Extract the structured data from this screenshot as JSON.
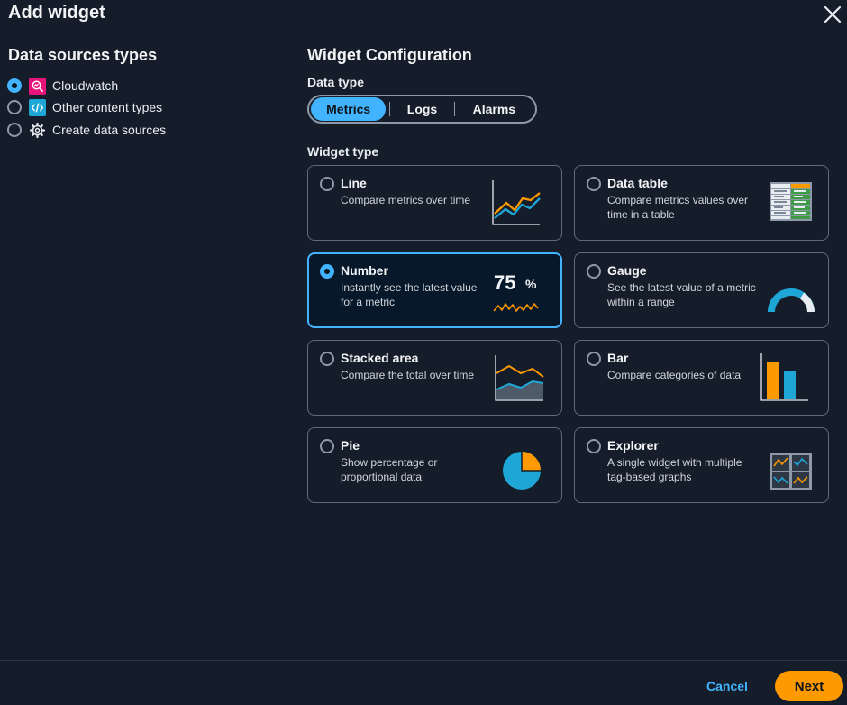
{
  "modal": {
    "title": "Add widget"
  },
  "left": {
    "heading": "Data sources types",
    "sources": [
      {
        "label": "Cloudwatch",
        "icon": "cloudwatch-icon",
        "checked": true
      },
      {
        "label": "Other content types",
        "icon": "code-icon",
        "checked": false
      },
      {
        "label": "Create data sources",
        "icon": "gear-icon",
        "checked": false
      }
    ]
  },
  "config": {
    "heading": "Widget Configuration",
    "data_type_label": "Data type",
    "data_types": [
      "Metrics",
      "Logs",
      "Alarms"
    ],
    "active_data_type": "Metrics",
    "widget_type_label": "Widget type",
    "widgets": [
      {
        "title": "Line",
        "desc": "Compare metrics over time",
        "icon": "line-chart-icon",
        "selected": false
      },
      {
        "title": "Data table",
        "desc": "Compare metrics values over time in a table",
        "icon": "data-table-icon",
        "selected": false
      },
      {
        "title": "Number",
        "desc": "Instantly see the latest value for a metric",
        "icon": "number-icon",
        "selected": true,
        "number": "75",
        "unit": "%"
      },
      {
        "title": "Gauge",
        "desc": "See the latest value of a metric within a range",
        "icon": "gauge-icon",
        "selected": false
      },
      {
        "title": "Stacked area",
        "desc": "Compare the total over time",
        "icon": "stacked-area-icon",
        "selected": false
      },
      {
        "title": "Bar",
        "desc": "Compare categories of data",
        "icon": "bar-chart-icon",
        "selected": false
      },
      {
        "title": "Pie",
        "desc": "Show percentage or proportional data",
        "icon": "pie-chart-icon",
        "selected": false
      },
      {
        "title": "Explorer",
        "desc": "A single widget with multiple tag-based graphs",
        "icon": "explorer-icon",
        "selected": false
      }
    ]
  },
  "footer": {
    "cancel": "Cancel",
    "next": "Next"
  },
  "colors": {
    "accent": "#42b4ff",
    "primary": "#ff9900",
    "background": "#161d2a",
    "orange": "#ff9900",
    "blue": "#1ea7d6",
    "pink": "#e7157b"
  }
}
